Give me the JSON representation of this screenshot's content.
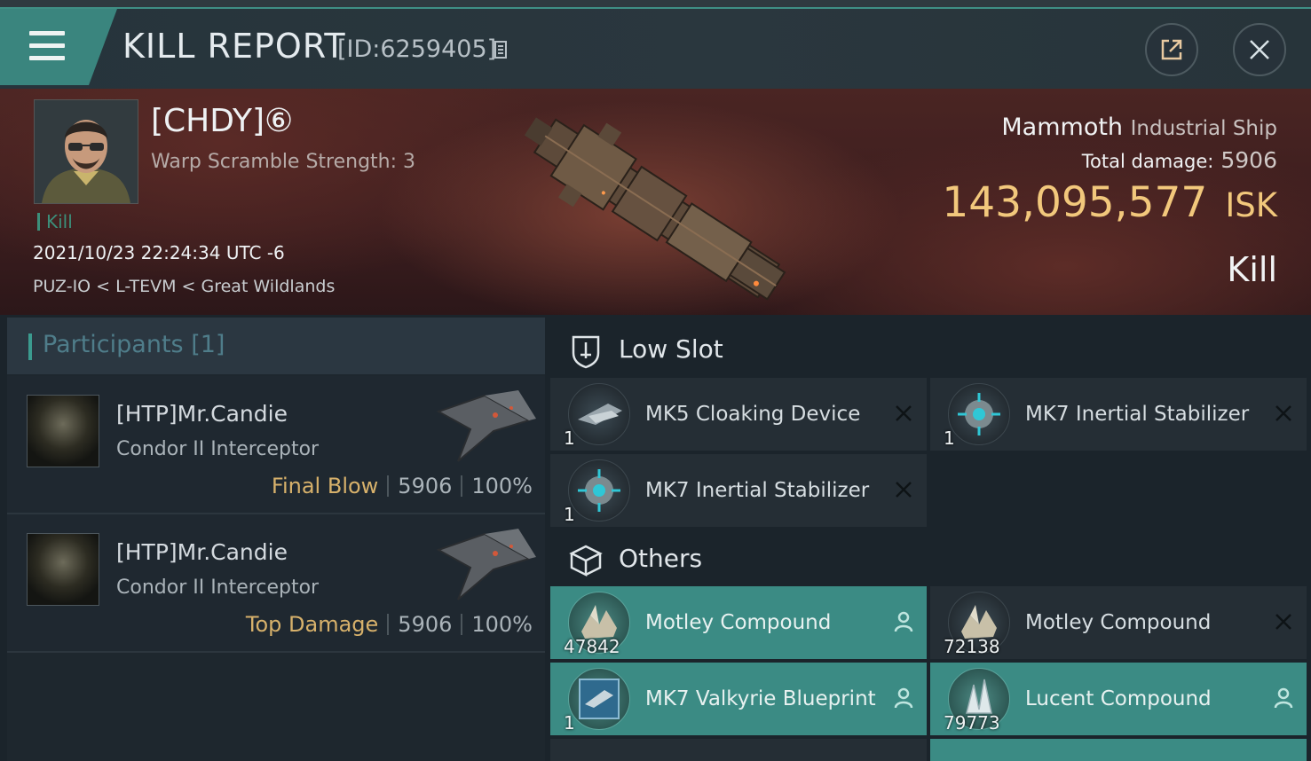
{
  "header": {
    "title": "KILL REPORT",
    "report_id": "[ID:6259405]"
  },
  "victim": {
    "corp_name": "[CHDY]⑥",
    "warp_scramble": "Warp Scramble Strength: 3",
    "kill_tag": "Kill",
    "datetime": "2021/10/23 22:24:34 UTC -6",
    "location": "PUZ-IO < L-TEVM < Great Wildlands",
    "ship_name": "Mammoth",
    "ship_class": "Industrial Ship",
    "total_damage_label": "Total damage:",
    "total_damage": "5906",
    "isk_value": "143,095,577",
    "isk_unit": "ISK",
    "result": "Kill"
  },
  "participants": {
    "label": "Participants",
    "count": "[1]",
    "rows": [
      {
        "name": "[HTP]Mr.Candie",
        "ship": "Condor II Interceptor",
        "label": "Final Blow",
        "damage": "5906",
        "percent": "100%"
      },
      {
        "name": "[HTP]Mr.Candie",
        "ship": "Condor II Interceptor",
        "label": "Top Damage",
        "damage": "5906",
        "percent": "100%"
      }
    ]
  },
  "low_slot": {
    "label": "Low Slot",
    "items": [
      {
        "name": "MK5 Cloaking Device",
        "qty": "1",
        "status": "destroyed"
      },
      {
        "name": "MK7 Inertial Stabilizer",
        "qty": "1",
        "status": "destroyed"
      },
      {
        "name": "MK7 Inertial Stabilizer",
        "qty": "1",
        "status": "destroyed"
      }
    ]
  },
  "others": {
    "label": "Others",
    "items": [
      {
        "name": "Motley Compound",
        "qty": "47842",
        "status": "dropped"
      },
      {
        "name": "Motley Compound",
        "qty": "72138",
        "status": "destroyed"
      },
      {
        "name": "MK7 Valkyrie Blueprint",
        "qty": "1",
        "status": "dropped"
      },
      {
        "name": "Lucent Compound",
        "qty": "79773",
        "status": "dropped"
      }
    ]
  },
  "icons": {
    "menu": "hamburger-menu-icon",
    "copy": "copy-icon",
    "share": "external-share-icon",
    "close": "close-icon",
    "low_slot": "shield-slot-icon",
    "others": "cube-icon",
    "destroyed": "x-icon",
    "dropped": "person-icon"
  },
  "colors": {
    "accent": "#3b8b84",
    "isk": "#f2c87c",
    "final_blow": "#d7b16b",
    "kill_tag": "#3c8f7a"
  }
}
